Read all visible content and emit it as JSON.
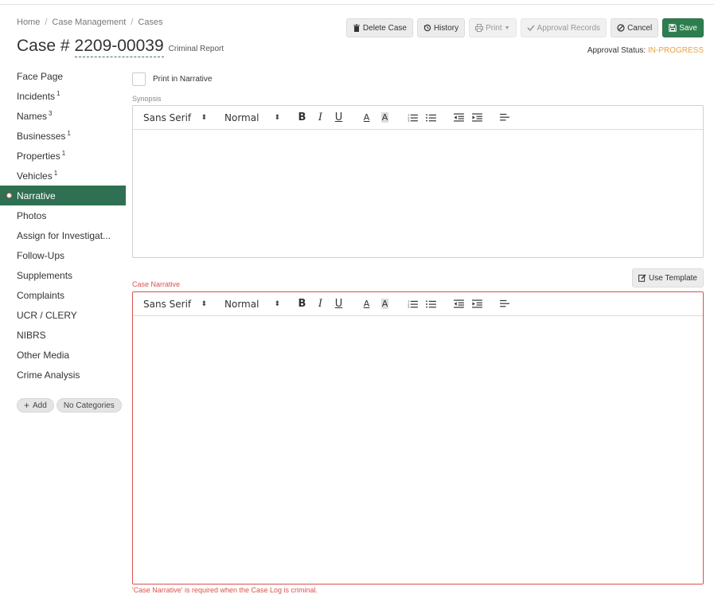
{
  "breadcrumb": [
    "Home",
    "Case Management",
    "Cases"
  ],
  "case": {
    "prefix": "Case #",
    "number": "2209-00039",
    "type": "Criminal Report"
  },
  "toolbar": {
    "delete": "Delete Case",
    "history": "History",
    "print": "Print",
    "approval_records": "Approval Records",
    "cancel": "Cancel",
    "save": "Save"
  },
  "approval": {
    "label": "Approval Status: ",
    "status": "IN-PROGRESS",
    "status_color": "#e8a33d"
  },
  "sidebar": {
    "items": [
      {
        "label": "Face Page",
        "count": ""
      },
      {
        "label": "Incidents",
        "count": "1"
      },
      {
        "label": "Names",
        "count": "3"
      },
      {
        "label": "Businesses",
        "count": "1"
      },
      {
        "label": "Properties",
        "count": "1"
      },
      {
        "label": "Vehicles",
        "count": "1"
      },
      {
        "label": "Narrative",
        "count": ""
      },
      {
        "label": "Photos",
        "count": ""
      },
      {
        "label": "Assign for Investigat...",
        "count": ""
      },
      {
        "label": "Follow-Ups",
        "count": ""
      },
      {
        "label": "Supplements",
        "count": ""
      },
      {
        "label": "Complaints",
        "count": ""
      },
      {
        "label": "UCR / CLERY",
        "count": ""
      },
      {
        "label": "NIBRS",
        "count": ""
      },
      {
        "label": "Other Media",
        "count": ""
      },
      {
        "label": "Crime Analysis",
        "count": ""
      }
    ],
    "add_label": "Add",
    "categories_label": "No Categories"
  },
  "narrative": {
    "print_in_narrative": "Print in Narrative",
    "synopsis_label": "Synopsis",
    "case_narrative_label": "Case Narrative",
    "use_template": "Use Template",
    "error": "'Case Narrative' is required when the Case Log is criminal."
  },
  "editor": {
    "font": "Sans Serif",
    "size": "Normal"
  },
  "colors": {
    "brand": "#2e7051",
    "save": "#2e7d4f",
    "error": "#d9534f"
  }
}
